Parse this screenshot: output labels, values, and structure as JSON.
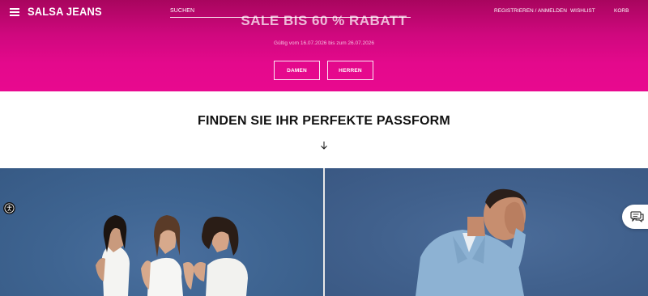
{
  "header": {
    "brand": "SALSA JEANS",
    "menu_icon": "hamburger-menu-icon",
    "search": {
      "label": "SUCHEN"
    },
    "links": {
      "account": "REGISTRIEREN / ANMELDEN",
      "wishlist": "WISHLIST",
      "cart": "KORB"
    }
  },
  "hero": {
    "title": "SALE BIS 60 % RABATT",
    "validity": "Gültig vom 16.07.2026 bis zum 26.07.2026",
    "buttons": {
      "women": "DAMEN",
      "men": "HERREN"
    },
    "colors": {
      "top": "#a8055e",
      "bottom": "#e8098f"
    }
  },
  "fit_section": {
    "title": "FINDEN SIE IHR PERFEKTE PASSFORM",
    "arrow_icon": "arrow-down-icon"
  },
  "tiles": {
    "women_icon": "women-models-photo",
    "men_icon": "man-model-photo",
    "background_color": "#3f6592"
  },
  "floating": {
    "accessibility_icon": "accessibility-icon",
    "chat_icon": "chat-bubble-icon"
  }
}
